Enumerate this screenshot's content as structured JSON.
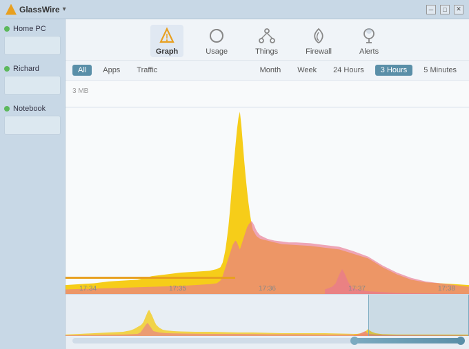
{
  "titlebar": {
    "title": "GlassWire",
    "caret": "▾",
    "minimize": "─",
    "maximize": "□",
    "close": "✕"
  },
  "sidebar": {
    "items": [
      {
        "id": "home-pc",
        "label": "Home PC",
        "active": true
      },
      {
        "id": "richard",
        "label": "Richard",
        "active": true
      },
      {
        "id": "notebook",
        "label": "Notebook",
        "active": true
      }
    ]
  },
  "toolbar": {
    "items": [
      {
        "id": "graph",
        "label": "Graph",
        "icon": "triangle-icon",
        "active": true
      },
      {
        "id": "usage",
        "label": "Usage",
        "icon": "circle-icon",
        "active": false
      },
      {
        "id": "things",
        "label": "Things",
        "icon": "share-icon",
        "active": false
      },
      {
        "id": "firewall",
        "label": "Firewall",
        "icon": "flame-icon",
        "active": false
      },
      {
        "id": "alerts",
        "label": "Alerts",
        "icon": "pin-icon",
        "active": false
      }
    ]
  },
  "filters": {
    "left": [
      {
        "id": "all",
        "label": "All",
        "active": true
      },
      {
        "id": "apps",
        "label": "Apps",
        "active": false
      },
      {
        "id": "traffic",
        "label": "Traffic",
        "active": false
      }
    ],
    "right": [
      {
        "id": "month",
        "label": "Month",
        "active": false
      },
      {
        "id": "week",
        "label": "Week",
        "active": false
      },
      {
        "id": "24hours",
        "label": "24 Hours",
        "active": false
      },
      {
        "id": "3hours",
        "label": "3 Hours",
        "active": true
      },
      {
        "id": "5minutes",
        "label": "5 Minutes",
        "active": false
      }
    ]
  },
  "graph": {
    "y_label": "3 MB",
    "time_labels": [
      "17:34",
      "17:35",
      "17:36",
      "17:37",
      "17:38"
    ]
  },
  "colors": {
    "yellow": "#f5c800",
    "pink": "#e87890",
    "orange": "#e8a020",
    "teal": "#5a8fa8"
  }
}
